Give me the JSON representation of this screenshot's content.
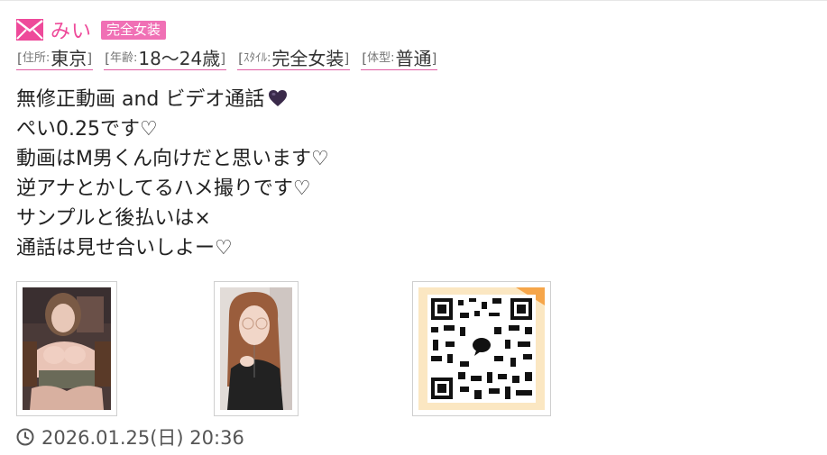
{
  "post": {
    "name": "みい",
    "badge": "完全女装",
    "tags": [
      {
        "label": "住所:",
        "value": "東京"
      },
      {
        "label": "年齢:",
        "value": "18〜24歳"
      },
      {
        "label": "ｽﾀｲﾙ:",
        "value": "完全女装"
      },
      {
        "label": "体型:",
        "value": "普通"
      }
    ],
    "message": {
      "line1": "無修正動画 and ビデオ通話",
      "line2": "ぺい0.25です♡",
      "line3": "動画はM男くん向けだと思います♡",
      "line4": "逆アナとかしてるハメ撮りです♡",
      "line5": "サンプルと後払いは×",
      "line6": "通話は見せ合いしよー♡"
    },
    "date": "2026.01.25(日) 20:36"
  },
  "colors": {
    "accent": "#ee4a9a",
    "badge_bg": "#f070b5",
    "heart": "#3a2a4a"
  },
  "icons": [
    "mail-icon",
    "black-heart-icon",
    "clock-icon"
  ]
}
